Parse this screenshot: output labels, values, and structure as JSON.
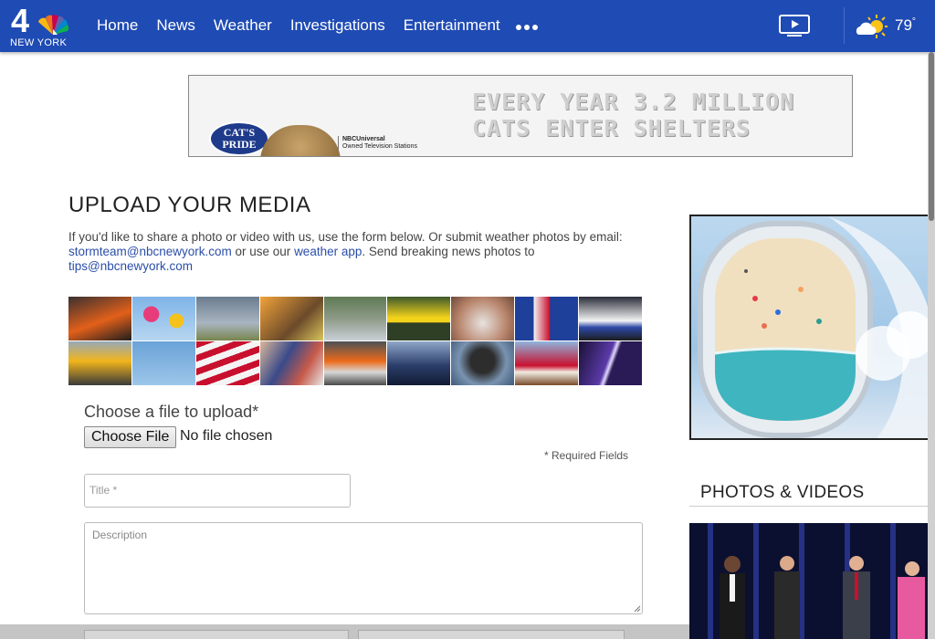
{
  "header": {
    "logo_number": "4",
    "logo_city": "NEW YORK",
    "nav": [
      "Home",
      "News",
      "Weather",
      "Investigations",
      "Entertainment"
    ],
    "more_icon": "more-dots-icon",
    "tv_icon": "play-tv-icon",
    "weather_icon": "partly-sunny-icon",
    "temperature": "79",
    "temperature_unit": "°",
    "colors": {
      "bar": "#1f4bb4",
      "text": "#ffffff"
    }
  },
  "ad": {
    "brand": "CAT'S PRIDE",
    "network": "NBCUniversal",
    "network_sub": "Owned Television Stations",
    "headline_1": "EVERY YEAR 3.2 MILLION",
    "headline_2": "CATS ENTER SHELTERS"
  },
  "page": {
    "title": "UPLOAD YOUR MEDIA",
    "intro_1": "If you'd like to share a photo or video with us, use the form below. Or submit weather photos by email:",
    "email_weather": "stormteam@nbcnewyork.com",
    "intro_2": " or use our ",
    "weather_app": "weather app",
    "intro_3": ". Send breaking news photos to",
    "email_tips": "tips@nbcnewyork.com"
  },
  "form": {
    "file_label": "Choose a file to upload*",
    "file_button": "Choose File",
    "file_status": "No file chosen",
    "required_note": "*  Required Fields",
    "title_placeholder": "Title *",
    "description_placeholder": "Description"
  },
  "sidebar": {
    "section_title": "PHOTOS & VIDEOS"
  }
}
